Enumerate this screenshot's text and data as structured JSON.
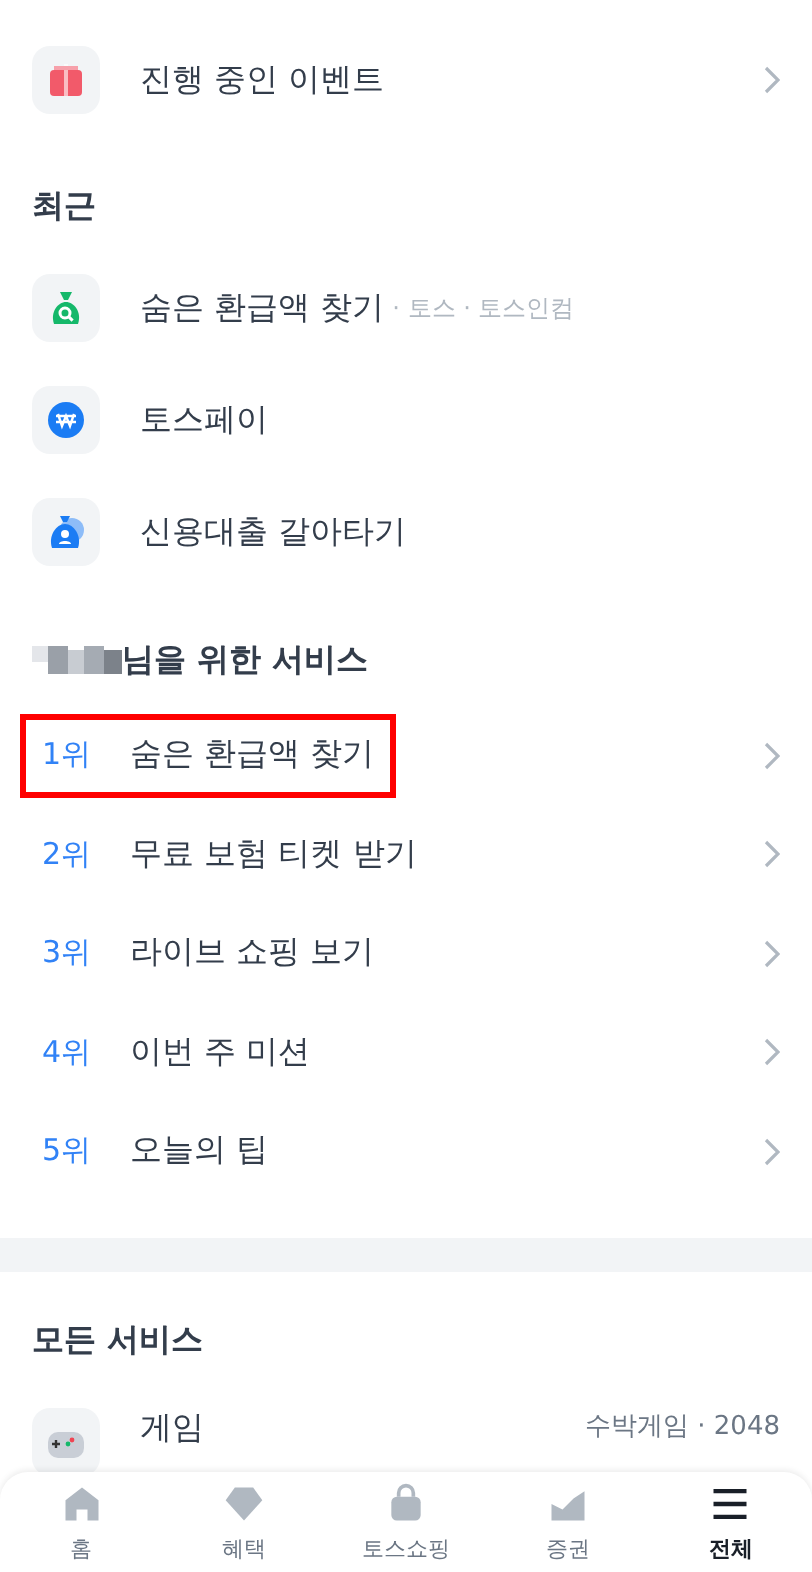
{
  "event_row": {
    "label": "진행 중인 이벤트",
    "kind": "gift"
  },
  "recent": {
    "title": "최근",
    "items": [
      {
        "label": "숨은 환급액 찾기",
        "meta": "· 토스 · 토스인컴",
        "kind": "search-bag"
      },
      {
        "label": "토스페이",
        "kind": "won-coin"
      },
      {
        "label": "신용대출 갈아타기",
        "kind": "person-bag"
      }
    ]
  },
  "for_you": {
    "title": "님을 위한 서비스",
    "items": [
      {
        "rank": "1위",
        "label": "숨은 환급액 찾기",
        "highlighted": true
      },
      {
        "rank": "2위",
        "label": "무료 보험 티켓 받기",
        "highlighted": false
      },
      {
        "rank": "3위",
        "label": "라이브 쇼핑 보기",
        "highlighted": false
      },
      {
        "rank": "4위",
        "label": "이번 주 미션",
        "highlighted": false
      },
      {
        "rank": "5위",
        "label": "오늘의 팁",
        "highlighted": false
      }
    ]
  },
  "all_services": {
    "title": "모든 서비스",
    "items": [
      {
        "label": "게임",
        "meta": "수박게임 · 2048",
        "kind": "gamepad"
      }
    ]
  },
  "tab_bar": [
    {
      "label": "홈",
      "kind": "home",
      "selected": false
    },
    {
      "label": "혜택",
      "kind": "gem",
      "selected": false
    },
    {
      "label": "토스쇼핑",
      "kind": "bag",
      "selected": false
    },
    {
      "label": "증권",
      "kind": "chart",
      "selected": false
    },
    {
      "label": "전체",
      "kind": "menu",
      "selected": true
    }
  ]
}
